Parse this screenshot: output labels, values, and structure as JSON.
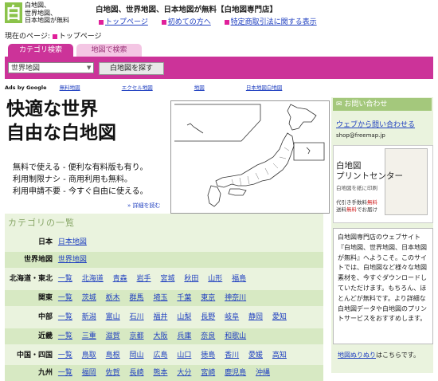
{
  "header": {
    "logo_char": "白",
    "logo_lines": [
      "白地図、",
      "世界地図、",
      "日本地図が無料"
    ],
    "site_title": "白地図、世界地図、日本地図が無料【白地図専門店】",
    "nav": [
      "トップページ",
      "初めての方へ",
      "特定商取引法に関する表示"
    ]
  },
  "breadcrumb": {
    "label": "現在のページ:",
    "current": "トップページ"
  },
  "search": {
    "tabs": [
      "カテゴリ検索",
      "地図で検索"
    ],
    "select_value": "世界地図",
    "button_label": "白地図を探す"
  },
  "ads": {
    "label": "Ads by Google",
    "links": [
      "無料地図",
      "エクセル地図",
      "地図",
      "日本地図白地図"
    ]
  },
  "hero": {
    "line1": "快適な世界",
    "line2": "自由な白地図",
    "features": [
      "無料で使える - 便利な有料版も有り。",
      "利用制限ナシ - 商用利用も無料。",
      "利用申請不要 - 今すぐ自由に使える。"
    ],
    "detail_link": "» 詳細を読む"
  },
  "categories": {
    "heading": "カテゴリの一覧",
    "rows": [
      {
        "region": "日本",
        "links": [
          "日本地図"
        ]
      },
      {
        "region": "世界地図",
        "links": [
          "世界地図"
        ]
      },
      {
        "region": "北海道・東北",
        "links": [
          "一覧",
          "北海道",
          "青森",
          "岩手",
          "宮城",
          "秋田",
          "山形",
          "福島"
        ]
      },
      {
        "region": "関東",
        "links": [
          "一覧",
          "茨城",
          "栃木",
          "群馬",
          "埼玉",
          "千葉",
          "東京",
          "神奈川"
        ]
      },
      {
        "region": "中部",
        "links": [
          "一覧",
          "新潟",
          "富山",
          "石川",
          "福井",
          "山梨",
          "長野",
          "岐阜",
          "静岡",
          "愛知"
        ]
      },
      {
        "region": "近畿",
        "links": [
          "一覧",
          "三重",
          "滋賀",
          "京都",
          "大阪",
          "兵庫",
          "奈良",
          "和歌山"
        ]
      },
      {
        "region": "中国・四国",
        "links": [
          "一覧",
          "鳥取",
          "島根",
          "岡山",
          "広島",
          "山口",
          "徳島",
          "香川",
          "愛媛",
          "高知"
        ]
      },
      {
        "region": "九州",
        "links": [
          "一覧",
          "福岡",
          "佐賀",
          "長崎",
          "熊本",
          "大分",
          "宮崎",
          "鹿児島",
          "沖縄"
        ]
      }
    ]
  },
  "sidebar": {
    "contact_heading": "お問い合わせ",
    "contact_link": "ウェブから問い合わせる",
    "email": "shop@freemap.jp",
    "print_title": [
      "白地図",
      "プリントセンター"
    ],
    "print_sub": "白地図を紙に印刷",
    "print_note_a": "代引き手数料",
    "print_note_free1": "無料",
    "print_note_b": "送料",
    "print_note_free2": "無料",
    "print_note_c": "でお届け",
    "intro": "白地図専門店のウェブサイト『白地図、世界地図、日本地図が無料』へようこそ。このサイトでは、白地図など様々な地図素材を、今すぐダウンロードしていただけます。もちろん、ほとんどが無料です。より詳細な白地図データや白地図のプリントサービスをおすすめします。",
    "coloring_link": "地図ぬりぬり",
    "coloring_suffix": "はこちらです。"
  },
  "colors": {
    "accent_pink": "#cc3399",
    "green_panel": "#eaf3de",
    "link_blue": "#2040c0"
  }
}
